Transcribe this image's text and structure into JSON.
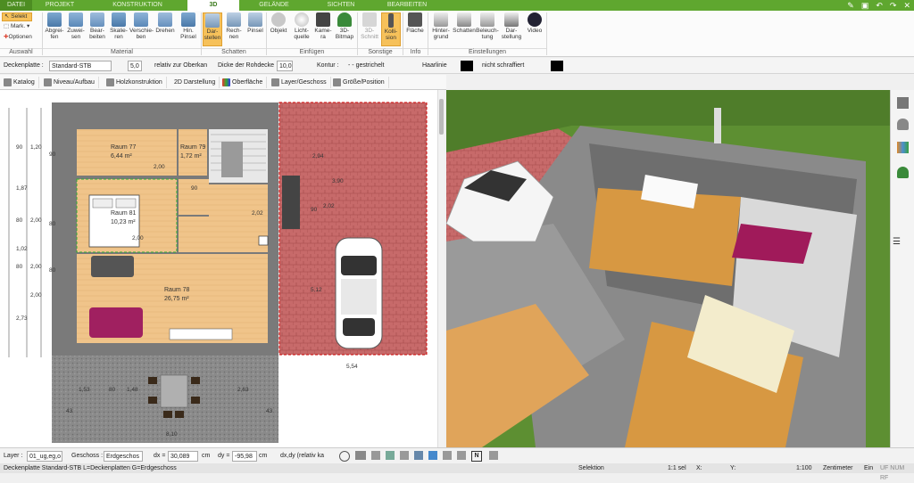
{
  "tabs": [
    {
      "label": "DATEI"
    },
    {
      "label": "PROJEKT"
    },
    {
      "label": "KONSTRUKTION"
    },
    {
      "label": "3D"
    },
    {
      "label": "GELÄNDE"
    },
    {
      "label": "SICHTEN"
    },
    {
      "label": "BEARBEITEN"
    }
  ],
  "ribbon": {
    "selekt": "Selekt",
    "mark": "Mark.",
    "optionen": "Optionen",
    "buttons": [
      {
        "label": "Abgrei-\nfen"
      },
      {
        "label": "Zuwei-\nsen"
      },
      {
        "label": "Bear-\nbeiten"
      },
      {
        "label": "Skalie-\nren"
      },
      {
        "label": "Verschie-\nben"
      },
      {
        "label": "Drehen"
      },
      {
        "label": "Hin.\nPinsel"
      },
      {
        "label": "Dar-\nstellen"
      },
      {
        "label": "Rech-\nnen"
      },
      {
        "label": "Pinsel"
      },
      {
        "label": "Objekt"
      },
      {
        "label": "Licht-\nquelle"
      },
      {
        "label": "Kame-\nra"
      },
      {
        "label": "3D-\nBitmap"
      },
      {
        "label": "3D-\nSchnitt"
      },
      {
        "label": "Kolli-\nsion"
      },
      {
        "label": "Fläche"
      },
      {
        "label": "Hinter-\ngrund"
      },
      {
        "label": "Schatten"
      },
      {
        "label": "Beleuch-\ntung"
      },
      {
        "label": "Dar-\nstellung"
      },
      {
        "label": "Video"
      }
    ],
    "groups": [
      {
        "label": "Auswahl"
      },
      {
        "label": "Material"
      },
      {
        "label": "Schatten"
      },
      {
        "label": "Einfügen"
      },
      {
        "label": "Sonstige"
      },
      {
        "label": "Info"
      },
      {
        "label": "Einstellungen"
      }
    ]
  },
  "props": {
    "element": "Deckenplatte :",
    "type": "Standard-STB",
    "height": "5,0",
    "relative": "relativ zur Oberkan",
    "thickness_label": "Dicke der Rohdecke",
    "thickness": "10,0",
    "contour_label": "Kontur :",
    "contour": "gestrichelt",
    "line": "Haarlinie",
    "hatch": "nicht schraffiert"
  },
  "toolbar2": [
    {
      "label": "Katalog"
    },
    {
      "label": "Niveau/Aufbau"
    },
    {
      "label": "Holzkonstruktion"
    },
    {
      "label": "2D Darstellung"
    },
    {
      "label": "Oberfläche"
    },
    {
      "label": "Layer/Geschoss"
    },
    {
      "label": "Größe/Position"
    }
  ],
  "plan": {
    "rooms": [
      {
        "name": "Raum 77",
        "area": "6,44 m²"
      },
      {
        "name": "Raum 79",
        "area": "1,72 m²"
      },
      {
        "name": "Raum 81",
        "area": "10,23 m²"
      },
      {
        "name": "Raum 78",
        "area": "26,75 m²"
      }
    ],
    "dims_left": [
      "90",
      "1,20",
      "1,87",
      "80",
      "2,00",
      "80",
      "2,00",
      "2,73",
      "90",
      "1,02",
      "80",
      "80",
      "2,00"
    ],
    "dims_bottom": [
      "1,53",
      "80",
      "1,48",
      "2,63",
      "43",
      "8,10",
      "43"
    ],
    "dims_misc": [
      "5,54",
      "2,94",
      "3,90",
      "90",
      "2,02",
      "5,12",
      "2,00",
      "2,02",
      "90",
      "2,00"
    ]
  },
  "bottom": {
    "layer_label": "Layer :",
    "layer": "01_ug,eg,o",
    "geschoss_label": "Geschoss :",
    "geschoss": "Erdgeschos",
    "dx_label": "dx =",
    "dx": "30,089",
    "dx_unit": "cm",
    "dy_label": "dy =",
    "dy": "-95,98",
    "dy_unit": "cm",
    "mode": "dx,dy (relativ ka"
  },
  "status": {
    "left": "Deckenplatte Standard-STB L=Deckenplatten G=Erdgeschoss",
    "mode": "Selektion",
    "sel": "1:1 sel",
    "x": "X:",
    "y": "Y:",
    "scale": "1:100",
    "unit": "Zentimeter",
    "ein": "Ein",
    "flags": "UF NUM RF"
  }
}
